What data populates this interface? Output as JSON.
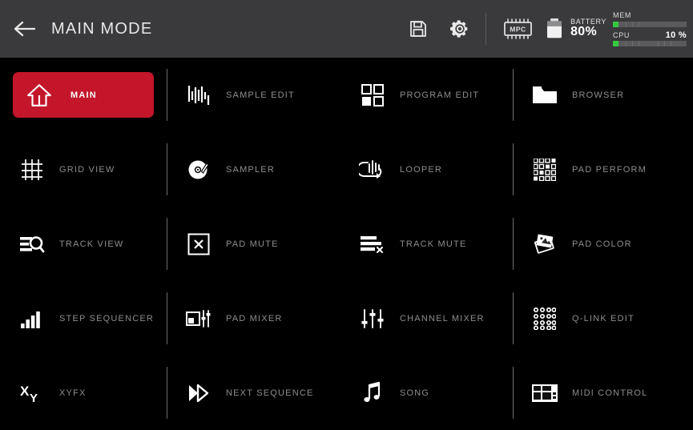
{
  "header": {
    "back_icon": "arrow-left-icon",
    "title": "MAIN MODE",
    "save_icon": "save-floppy-icon",
    "settings_icon": "gear-icon",
    "chip_icon": "mpc-chip-icon",
    "chip_text": "MPC",
    "battery": {
      "icon": "battery-icon",
      "label": "BATTERY",
      "value": "80%"
    },
    "meters": [
      {
        "name": "MEM",
        "value": "",
        "percent": 8,
        "color": "#35c940"
      },
      {
        "name": "CPU",
        "value": "10 %",
        "percent": 8,
        "color": "#35c940"
      }
    ]
  },
  "grid": {
    "columns": 4,
    "rows": 5,
    "items": [
      {
        "label": "MAIN",
        "icon": "home-up-arrow-icon",
        "active": true,
        "separator": false
      },
      {
        "label": "SAMPLE EDIT",
        "icon": "waveform-icon",
        "active": false,
        "separator": true
      },
      {
        "label": "PROGRAM EDIT",
        "icon": "four-squares-icon",
        "active": false,
        "separator": false
      },
      {
        "label": "BROWSER",
        "icon": "folder-icon",
        "active": false,
        "separator": true
      },
      {
        "label": "GRID VIEW",
        "icon": "grid-mesh-icon",
        "active": false,
        "separator": false
      },
      {
        "label": "SAMPLER",
        "icon": "turntable-icon",
        "active": false,
        "separator": true
      },
      {
        "label": "LOOPER",
        "icon": "loop-waveform-icon",
        "active": false,
        "separator": false
      },
      {
        "label": "PAD PERFORM",
        "icon": "pad-grid-16-icon",
        "active": false,
        "separator": true
      },
      {
        "label": "TRACK VIEW",
        "icon": "bars-magnifier-icon",
        "active": false,
        "separator": false
      },
      {
        "label": "PAD MUTE",
        "icon": "square-x-icon",
        "active": false,
        "separator": true
      },
      {
        "label": "TRACK MUTE",
        "icon": "bars-x-icon",
        "active": false,
        "separator": false
      },
      {
        "label": "PAD COLOR",
        "icon": "color-swatch-icon",
        "active": false,
        "separator": true
      },
      {
        "label": "STEP SEQUENCER",
        "icon": "ascending-bars-icon",
        "active": false,
        "separator": false
      },
      {
        "label": "PAD MIXER",
        "icon": "pad-faders-icon",
        "active": false,
        "separator": true
      },
      {
        "label": "CHANNEL MIXER",
        "icon": "faders-icon",
        "active": false,
        "separator": false
      },
      {
        "label": "Q-LINK EDIT",
        "icon": "knob-grid-icon",
        "active": false,
        "separator": true
      },
      {
        "label": "XYFX",
        "icon": "xy-letters-icon",
        "active": false,
        "separator": false
      },
      {
        "label": "NEXT SEQUENCE",
        "icon": "double-chevron-icon",
        "active": false,
        "separator": true
      },
      {
        "label": "SONG",
        "icon": "music-note-icon",
        "active": false,
        "separator": false
      },
      {
        "label": "MIDI CONTROL",
        "icon": "screen-layout-icon",
        "active": false,
        "separator": true
      }
    ]
  },
  "colors": {
    "accent": "#c3162a",
    "header_bg": "#3a3a3c",
    "bg": "#000000",
    "label": "#8d8d8d",
    "meter_green": "#35c940"
  }
}
